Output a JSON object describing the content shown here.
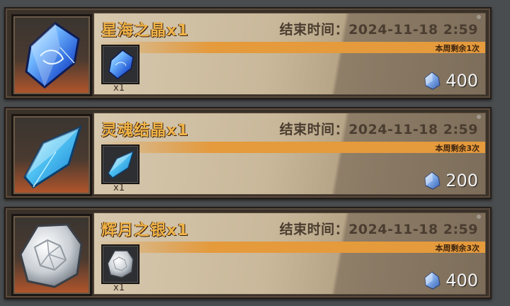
{
  "offers": [
    {
      "title": "星海之晶x1",
      "end_time": "结束时间：2024-11-18 2:59",
      "weekly_limit": "本周剩余1次",
      "quantity": "x1",
      "price": "400",
      "item_icon": "blue-crystal-icon",
      "currency_icon": "diamond-currency-icon"
    },
    {
      "title": "灵魂结晶x1",
      "end_time": "结束时间：2024-11-18 2:59",
      "weekly_limit": "本周剩余3次",
      "quantity": "x1",
      "price": "200",
      "item_icon": "soul-shard-icon",
      "currency_icon": "diamond-currency-icon"
    },
    {
      "title": "辉月之银x1",
      "end_time": "结束时间：2024-11-18 2:59",
      "weekly_limit": "本周剩余3次",
      "quantity": "x1",
      "price": "400",
      "item_icon": "silver-ore-icon",
      "currency_icon": "diamond-currency-icon"
    }
  ],
  "colors": {
    "title": "#f0b347",
    "stripe": "#e59a3c",
    "panel": "#c9b89a",
    "background": "#4a4d4f"
  }
}
